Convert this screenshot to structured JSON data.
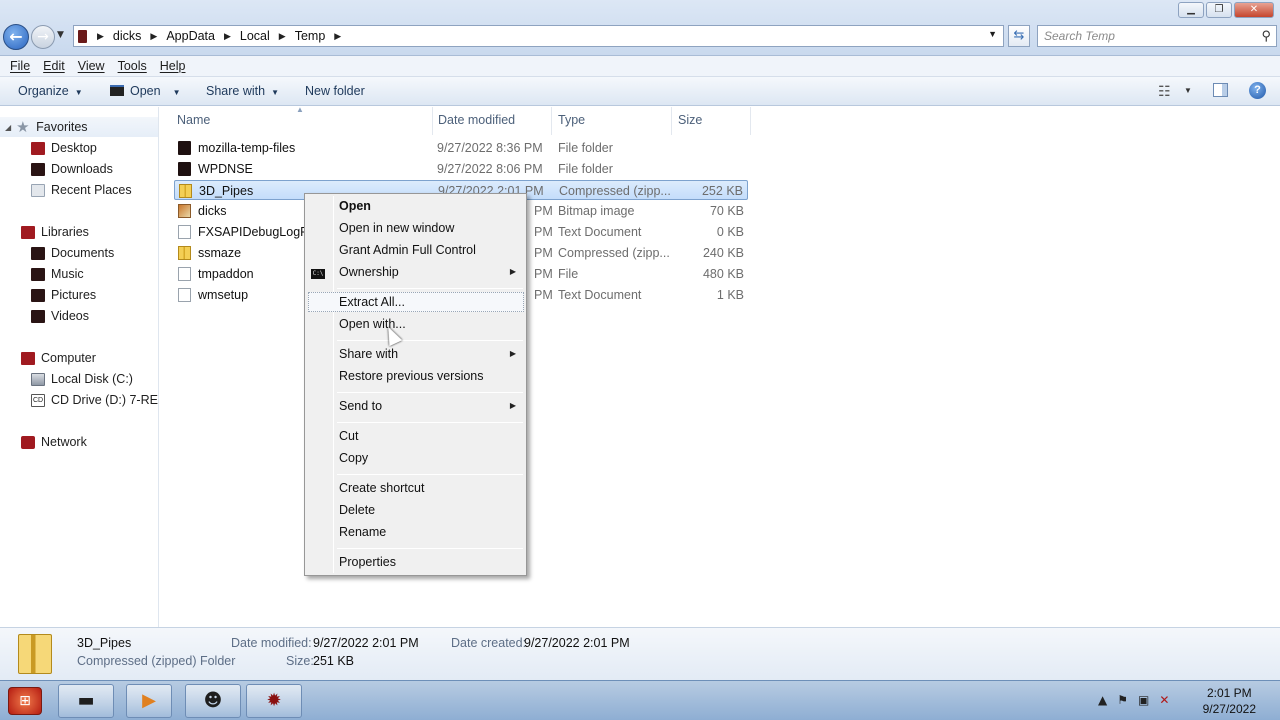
{
  "window": {
    "minimize": "▁",
    "maximize": "❐",
    "close": "✕"
  },
  "address": {
    "crumbs": [
      "dicks",
      "AppData",
      "Local",
      "Temp"
    ],
    "search_placeholder": "Search Temp"
  },
  "menubar": [
    "File",
    "Edit",
    "View",
    "Tools",
    "Help"
  ],
  "toolbar": {
    "organize": "Organize",
    "open": "Open",
    "share_with": "Share with",
    "new_folder": "New folder"
  },
  "navpane": {
    "favorites": "Favorites",
    "fav_items": [
      "Desktop",
      "Downloads",
      "Recent Places"
    ],
    "libraries": "Libraries",
    "lib_items": [
      "Documents",
      "Music",
      "Pictures",
      "Videos"
    ],
    "computer": "Computer",
    "comp_items": [
      "Local Disk (C:)",
      "CD Drive (D:) 7-RED-"
    ],
    "network": "Network"
  },
  "columns": [
    "Name",
    "Date modified",
    "Type",
    "Size"
  ],
  "files": [
    {
      "name": "mozilla-temp-files",
      "date": "9/27/2022 8:36 PM",
      "type": "File folder",
      "size": "",
      "icon": "folder-icon"
    },
    {
      "name": "WPDNSE",
      "date": "9/27/2022 8:06 PM",
      "type": "File folder",
      "size": "",
      "icon": "folder-icon"
    },
    {
      "name": "3D_Pipes",
      "date": "9/27/2022 2:01 PM",
      "type": "Compressed (zipp...",
      "size": "252 KB",
      "icon": "zip-icon"
    },
    {
      "name": "dicks",
      "date": "PM",
      "type": "Bitmap image",
      "size": "70 KB",
      "icon": "bitmap-icon"
    },
    {
      "name": "FXSAPIDebugLogFile",
      "date": "PM",
      "type": "Text Document",
      "size": "0 KB",
      "icon": "text-file-icon"
    },
    {
      "name": "ssmaze",
      "date": "PM",
      "type": "Compressed (zipp...",
      "size": "240 KB",
      "icon": "zip-icon"
    },
    {
      "name": "tmpaddon",
      "date": "PM",
      "type": "File",
      "size": "480 KB",
      "icon": "file-icon"
    },
    {
      "name": "wmsetup",
      "date": "PM",
      "type": "Text Document",
      "size": "1 KB",
      "icon": "text-file-icon"
    }
  ],
  "context_menu": {
    "open": "Open",
    "open_new_window": "Open in new window",
    "grant_admin": "Grant Admin Full Control",
    "ownership": "Ownership",
    "extract_all": "Extract All...",
    "open_with": "Open with...",
    "share_with": "Share with",
    "restore_prev": "Restore previous versions",
    "send_to": "Send to",
    "cut": "Cut",
    "copy": "Copy",
    "create_shortcut": "Create shortcut",
    "delete": "Delete",
    "rename": "Rename",
    "properties": "Properties"
  },
  "details": {
    "name": "3D_Pipes",
    "kind": "Compressed (zipped) Folder",
    "date_modified_label": "Date modified:",
    "date_modified": "9/27/2022 2:01 PM",
    "date_created_label": "Date created:",
    "date_created": "9/27/2022 2:01 PM",
    "size_label": "Size:",
    "size": "251 KB"
  },
  "taskbar": {
    "time": "2:01 PM",
    "date": "9/27/2022"
  }
}
